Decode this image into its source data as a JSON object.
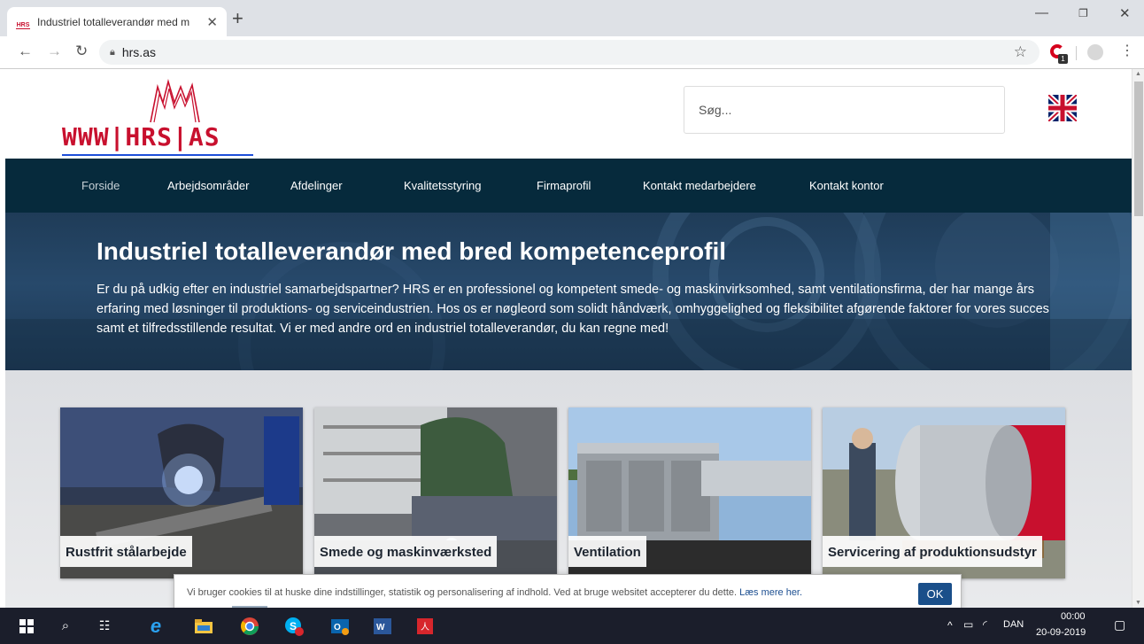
{
  "browser": {
    "tab_title": "Industriel totalleverandør med m",
    "favicon_text": "HRS",
    "url": "hrs.as"
  },
  "site": {
    "logo_text": "WWW|HRS|AS",
    "search_placeholder": "Søg...",
    "nav": [
      "Forside",
      "Arbejdsområder",
      "Afdelinger",
      "Kvalitetsstyring",
      "Firmaprofil",
      "Kontakt medarbejdere",
      "Kontakt kontor"
    ],
    "hero": {
      "title": "Industriel totalleverandør med bred kompetenceprofil",
      "text": "Er du på udkig efter en industriel samarbejdspartner? HRS er en professionel og kompetent smede- og maskinvirksomhed, samt ventilationsfirma, der har mange års erfaring med løsninger til produktions- og serviceindustrien. Hos os er nøgleord som solidt håndværk, omhyggelighed og fleksibilitet afgørende faktorer for vores succes samt et tilfredsstillende resultat. Vi er med andre ord en industriel totalleverandør, du kan regne med!"
    },
    "tiles": [
      "Rustfrit stålarbejde",
      "Smede og maskinværksted",
      "Ventilation",
      "Servicering af produktionsudstyr"
    ],
    "cookie": {
      "text": "Vi bruger cookies til at huske dine indstillinger, statistik og personalisering af indhold. Ved at bruge websitet accepterer du dette.",
      "link": "Læs mere her.",
      "ok": "OK"
    }
  },
  "taskbar": {
    "language": "DAN",
    "time": "00:00",
    "date": "20-09-2019"
  },
  "colors": {
    "navbar": "#062a3c",
    "logo_red": "#c8102e",
    "cookie_button": "#1a4f8a"
  }
}
